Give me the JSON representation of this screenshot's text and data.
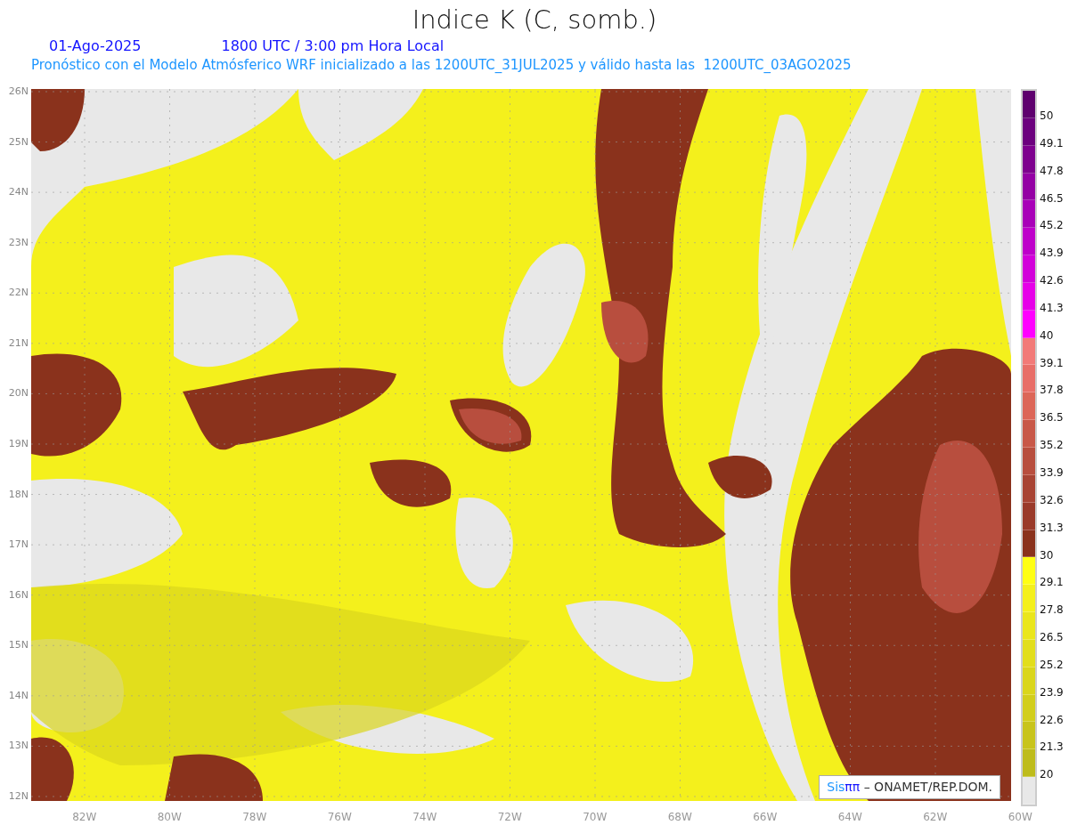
{
  "title": "Indice K (C, somb.)",
  "date": "01-Ago-2025",
  "time": "1800 UTC / 3:00 pm Hora Local",
  "subtitle": "Pronóstico con el Modelo Atmósferico WRF inicializado a las 1200UTC_31JUL2025 y válido hasta las  1200UTC_03AGO2025",
  "y_axis": [
    "26N",
    "25N",
    "24N",
    "23N",
    "22N",
    "21N",
    "20N",
    "19N",
    "18N",
    "17N",
    "16N",
    "15N",
    "14N",
    "13N",
    "12N"
  ],
  "x_axis": [
    "82W",
    "80W",
    "78W",
    "76W",
    "74W",
    "72W",
    "70W",
    "68W",
    "66W",
    "64W",
    "62W",
    "60W"
  ],
  "credit": {
    "logo_left": "Sis",
    "logo_right": "ππ",
    "text": "– ONAMET/REP.DOM."
  },
  "legend": {
    "bins": [
      {
        "color": "#5e006e"
      },
      {
        "color": "#6c007e"
      },
      {
        "color": "#7e008e"
      },
      {
        "color": "#9400a4"
      },
      {
        "color": "#a800b8"
      },
      {
        "color": "#be00ca"
      },
      {
        "color": "#d200da"
      },
      {
        "color": "#e600e8"
      },
      {
        "color": "#ff00ff"
      },
      {
        "color": "#f27a78"
      },
      {
        "color": "#e86e68"
      },
      {
        "color": "#dc6658"
      },
      {
        "color": "#c85848"
      },
      {
        "color": "#b84e3e"
      },
      {
        "color": "#a84434"
      },
      {
        "color": "#9a3a2a"
      },
      {
        "color": "#8a321c"
      },
      {
        "color": "#ffff14"
      },
      {
        "color": "#f4f01c"
      },
      {
        "color": "#eae61c"
      },
      {
        "color": "#e2de1c"
      },
      {
        "color": "#dad61c"
      },
      {
        "color": "#d2ce1c"
      },
      {
        "color": "#c8c41c"
      },
      {
        "color": "#bebc1c"
      },
      {
        "color": "#e8e8e8"
      }
    ],
    "labels": [
      "50",
      "49.1",
      "47.8",
      "46.5",
      "45.2",
      "43.9",
      "42.6",
      "41.3",
      "40",
      "39.1",
      "37.8",
      "36.5",
      "35.2",
      "33.9",
      "32.6",
      "31.3",
      "30",
      "29.1",
      "27.8",
      "26.5",
      "25.2",
      "23.9",
      "22.6",
      "21.3",
      "20"
    ]
  }
}
